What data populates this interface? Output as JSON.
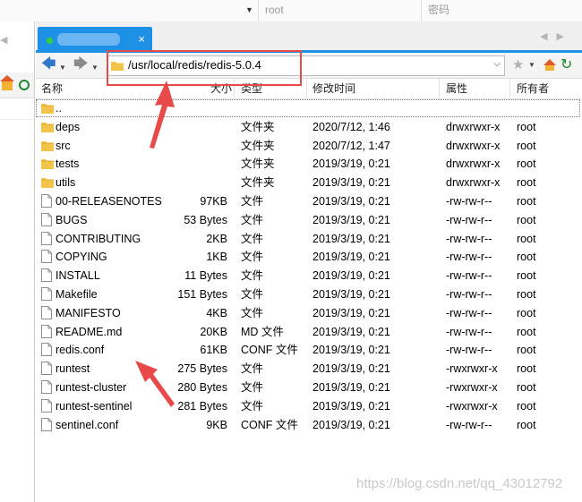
{
  "topbar": {
    "user_field": "root",
    "password_label": "密码"
  },
  "tab": {
    "close": "×"
  },
  "toolbar": {
    "path": "/usr/local/redis/redis-5.0.4"
  },
  "columns": {
    "name": "名称",
    "size": "大小",
    "type": "类型",
    "modified": "修改时间",
    "attributes": "属性",
    "owner": "所有者"
  },
  "files": [
    {
      "icon": "folder-icon",
      "name": "..",
      "size": "",
      "type": "",
      "modified": "",
      "perm": "",
      "owner": ""
    },
    {
      "icon": "folder-icon",
      "name": "deps",
      "size": "",
      "type": "文件夹",
      "modified": "2020/7/12, 1:46",
      "perm": "drwxrwxr-x",
      "owner": "root"
    },
    {
      "icon": "folder-icon",
      "name": "src",
      "size": "",
      "type": "文件夹",
      "modified": "2020/7/12, 1:47",
      "perm": "drwxrwxr-x",
      "owner": "root"
    },
    {
      "icon": "folder-icon",
      "name": "tests",
      "size": "",
      "type": "文件夹",
      "modified": "2019/3/19, 0:21",
      "perm": "drwxrwxr-x",
      "owner": "root"
    },
    {
      "icon": "folder-icon",
      "name": "utils",
      "size": "",
      "type": "文件夹",
      "modified": "2019/3/19, 0:21",
      "perm": "drwxrwxr-x",
      "owner": "root"
    },
    {
      "icon": "file-icon",
      "name": "00-RELEASENOTES",
      "size": "97KB",
      "type": "文件",
      "modified": "2019/3/19, 0:21",
      "perm": "-rw-rw-r--",
      "owner": "root"
    },
    {
      "icon": "file-icon",
      "name": "BUGS",
      "size": "53 Bytes",
      "type": "文件",
      "modified": "2019/3/19, 0:21",
      "perm": "-rw-rw-r--",
      "owner": "root"
    },
    {
      "icon": "file-icon",
      "name": "CONTRIBUTING",
      "size": "2KB",
      "type": "文件",
      "modified": "2019/3/19, 0:21",
      "perm": "-rw-rw-r--",
      "owner": "root"
    },
    {
      "icon": "file-icon",
      "name": "COPYING",
      "size": "1KB",
      "type": "文件",
      "modified": "2019/3/19, 0:21",
      "perm": "-rw-rw-r--",
      "owner": "root"
    },
    {
      "icon": "file-icon",
      "name": "INSTALL",
      "size": "11 Bytes",
      "type": "文件",
      "modified": "2019/3/19, 0:21",
      "perm": "-rw-rw-r--",
      "owner": "root"
    },
    {
      "icon": "file-icon",
      "name": "Makefile",
      "size": "151 Bytes",
      "type": "文件",
      "modified": "2019/3/19, 0:21",
      "perm": "-rw-rw-r--",
      "owner": "root"
    },
    {
      "icon": "file-icon",
      "name": "MANIFESTO",
      "size": "4KB",
      "type": "文件",
      "modified": "2019/3/19, 0:21",
      "perm": "-rw-rw-r--",
      "owner": "root"
    },
    {
      "icon": "file-icon",
      "name": "README.md",
      "size": "20KB",
      "type": "MD 文件",
      "modified": "2019/3/19, 0:21",
      "perm": "-rw-rw-r--",
      "owner": "root"
    },
    {
      "icon": "file-icon",
      "name": "redis.conf",
      "size": "61KB",
      "type": "CONF 文件",
      "modified": "2019/3/19, 0:21",
      "perm": "-rw-rw-r--",
      "owner": "root"
    },
    {
      "icon": "file-icon",
      "name": "runtest",
      "size": "275 Bytes",
      "type": "文件",
      "modified": "2019/3/19, 0:21",
      "perm": "-rwxrwxr-x",
      "owner": "root"
    },
    {
      "icon": "file-icon",
      "name": "runtest-cluster",
      "size": "280 Bytes",
      "type": "文件",
      "modified": "2019/3/19, 0:21",
      "perm": "-rwxrwxr-x",
      "owner": "root"
    },
    {
      "icon": "file-icon",
      "name": "runtest-sentinel",
      "size": "281 Bytes",
      "type": "文件",
      "modified": "2019/3/19, 0:21",
      "perm": "-rwxrwxr-x",
      "owner": "root"
    },
    {
      "icon": "file-icon",
      "name": "sentinel.conf",
      "size": "9KB",
      "type": "CONF 文件",
      "modified": "2019/3/19, 0:21",
      "perm": "-rw-rw-r--",
      "owner": "root"
    }
  ],
  "watermark": "https://blog.csdn.net/qq_43012792",
  "colors": {
    "accent": "#1e90e6",
    "annotation": "#e84a4a",
    "folder": "#f2c44a"
  }
}
